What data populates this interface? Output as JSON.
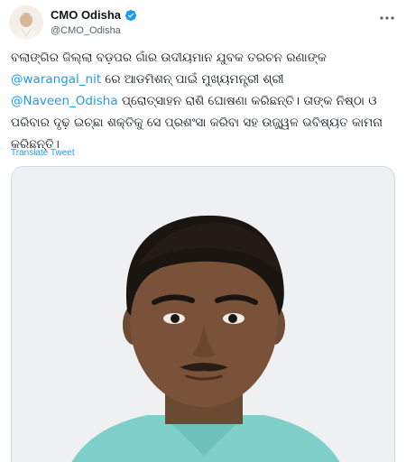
{
  "account": {
    "display_name": "CMO Odisha",
    "handle": "@CMO_Odisha",
    "verified": true
  },
  "tweet": {
    "text_part1": "ବଲାଙ୍ଗିର ଜିଲ୍ଲା ବଡ଼ପର ଗାଁର ଉଦୀୟମାନ ଯୁବକ ତରଚନ ରଣାଙ୍କ",
    "mention1": "@warangal_nit",
    "text_part2": " ରେ ଆଡମିଶନ୍ ପାଇଁ ମୁଖ୍ୟମନ୍ତ୍ରୀ ଶ୍ରୀ",
    "mention2": "@Naveen_Odisha",
    "text_part3": " ପ୍ରୋତ୍ସାହନ ରାଶି ଘୋଷଣା କରିଛନ୍ତି। ତାଙ୍କ ନିଷ୍ଠା ଓ ପରିବାର ଦୃଢ଼ ଇଚ୍ଛା ଶକ୍ତିକୁ ସେ ପ୍ରଶଂସା କରିବା ସହ ଉଜ୍ଜ୍ୱଳ ଭବିଷ୍ୟତ କାମନା କରିଛନ୍ତି।",
    "translate_label": "Translate Tweet"
  },
  "icons": {
    "verified": "verified-badge-icon",
    "more": "more-options-icon"
  },
  "colors": {
    "link": "#1d9bf0",
    "secondary_text": "#536471",
    "verified": "#1d9bf0"
  }
}
